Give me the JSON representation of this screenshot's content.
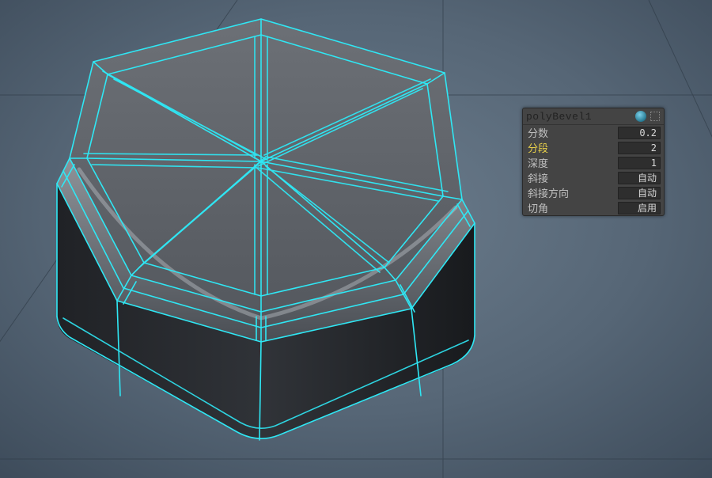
{
  "panel": {
    "title": "polyBevel1",
    "rows": [
      {
        "label": "分数",
        "value": "0.2",
        "highlight": false,
        "text": false
      },
      {
        "label": "分段",
        "value": "2",
        "highlight": true,
        "text": false
      },
      {
        "label": "深度",
        "value": "1",
        "highlight": false,
        "text": false
      },
      {
        "label": "斜接",
        "value": "自动",
        "highlight": false,
        "text": true
      },
      {
        "label": "斜接方向",
        "value": "自动",
        "highlight": false,
        "text": true
      },
      {
        "label": "切角",
        "value": "启用",
        "highlight": false,
        "text": true
      }
    ]
  }
}
